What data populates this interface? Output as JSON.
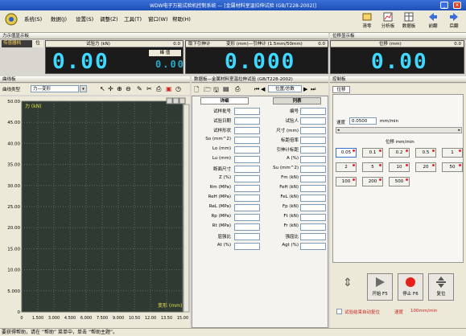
{
  "window": {
    "title": "WDW电子万能试验机控制系统 — [金属材料室温拉伸试验 (GB/T228-2002)]"
  },
  "menu": [
    "系统(S)",
    "数据(J)",
    "设置(S)",
    "调整(Z)",
    "工具(T)",
    "窗口(W)",
    "帮助(H)"
  ],
  "toolbar": {
    "clear": "清零",
    "analyze": "分析板",
    "data_board": "数据板",
    "forward": "前翻",
    "backward": "后翻"
  },
  "force_panel": {
    "title": "力示值显示板",
    "sensor_label": "传感器档",
    "sensor_value": "位",
    "cell_title": "试验力 (kN)",
    "cell_range": "0.0",
    "value": "0.00",
    "peak_label": "峰 值",
    "peak_value": "0.00"
  },
  "strain_panel": {
    "sensor": "取下引伸计",
    "cell_title": "变形 (mm)—引伸计 (1.5mm/50mm)",
    "cell_range": "0.0",
    "value": "0.000"
  },
  "disp_panel": {
    "title": "位移显示板",
    "cell_title": "位移 (mm)",
    "cell_range": "0.0",
    "value": "0.00"
  },
  "chart": {
    "header": "曲线板",
    "type_label": "曲线类型",
    "type_value": "力—变形",
    "inner_label": "力 (kN)"
  },
  "chart_data": {
    "type": "line",
    "xlabel": "变形 (mm)",
    "ylabel": "力 (kN)",
    "xlim": [
      0,
      15
    ],
    "ylim": [
      0,
      50
    ],
    "x_ticks": [
      "0",
      "1.500",
      "3.000",
      "4.500",
      "6.000",
      "7.500",
      "9.000",
      "10.50",
      "12.00",
      "13.50",
      "15.00"
    ],
    "y_ticks": [
      "50.00",
      "45.00",
      "40.00",
      "35.00",
      "30.00",
      "25.00",
      "20.00",
      "15.00",
      "10.00",
      "5.000",
      "0"
    ],
    "series": []
  },
  "data_table": {
    "header": "数据板—金属材料室温拉伸试验 (GB/T228-2002)",
    "nav_label": "位置/总数",
    "col_left": "详细",
    "col_right": "列表",
    "rows": [
      [
        "试样批号",
        "",
        "编号",
        ""
      ],
      [
        "试验日期",
        "",
        "试验人",
        ""
      ],
      [
        "试样形状",
        "",
        "尺寸 (mm)",
        ""
      ],
      [
        "So (mm^2)",
        "",
        "标距倍率",
        ""
      ],
      [
        "Lo (mm)",
        "",
        "引伸计标距",
        ""
      ],
      [
        "Lu (mm)",
        "",
        "A (%)",
        ""
      ],
      [
        "断面尺寸",
        "",
        "Su (mm^2)",
        ""
      ],
      [
        "Z (%)",
        "",
        "Fm (kN)",
        ""
      ],
      [
        "Rm (MPa)",
        "",
        "FeH (kN)",
        ""
      ],
      [
        "ReH (MPa)",
        "",
        "FeL (kN)",
        ""
      ],
      [
        "ReL (MPa)",
        "",
        "Fp (kN)",
        ""
      ],
      [
        "Rp (MPa)",
        "",
        "Ft (kN)",
        ""
      ],
      [
        "Rt (MPa)",
        "",
        "Fr (kN)",
        ""
      ],
      [
        "屈强比",
        "",
        "强屈比",
        ""
      ],
      [
        "At (%)",
        "",
        "Agt (%)",
        ""
      ]
    ]
  },
  "control": {
    "header": "控制板",
    "tab": "位移",
    "speed_label": "速度",
    "speed_value": "0.0500",
    "speed_unit": "mm/min",
    "group_label": "位移 mm/min",
    "buttons": [
      "0.05",
      "0.1",
      "0.2",
      "0.5",
      "1",
      "2",
      "5",
      "10",
      "20",
      "50",
      "100",
      "200",
      "500"
    ],
    "start": "开始 F5",
    "stop": "停止 F6",
    "reset": "复位",
    "auto_return": "试验结束自动复位",
    "return_speed": "速度",
    "return_speed_value": "100mm/min"
  },
  "status": {
    "text": "要获得帮助，请在 “帮助” 菜单中，单击 “帮助主题”。"
  },
  "colors": {
    "lcd_bg": "#1b1b1b",
    "lcd_fg": "#3fd8ff",
    "chart_bg": "#2f3a32",
    "title_blue": "#1d4fb8"
  }
}
